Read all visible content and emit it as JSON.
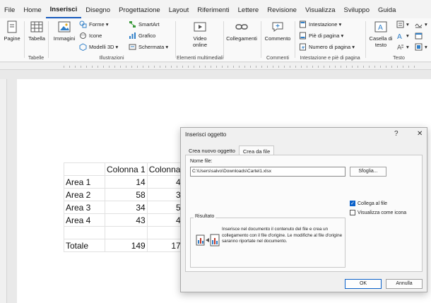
{
  "menu": {
    "tabs": [
      "File",
      "Home",
      "Inserisci",
      "Disegno",
      "Progettazione",
      "Layout",
      "Riferimenti",
      "Lettere",
      "Revisione",
      "Visualizza",
      "Sviluppo",
      "Guida"
    ],
    "active": "Inserisci"
  },
  "ribbon": {
    "pagine": "Pagine",
    "tabella": "Tabella",
    "tabelle_group": "Tabelle",
    "immagini": "Immagini",
    "forme": "Forme",
    "icone": "Icone",
    "modelli3d": "Modelli 3D",
    "smartart": "SmartArt",
    "grafico": "Grafico",
    "schermata": "Schermata",
    "illustrazioni_group": "Illustrazioni",
    "video_online": "Video online",
    "multimedia_group": "Elementi multimediali",
    "collegamenti": "Collegamenti",
    "commento": "Commento",
    "commenti_group": "Commenti",
    "intestazione": "Intestazione",
    "pie_pagina": "Piè di pagina",
    "numero_pagina": "Numero di pagina",
    "intestazione_group": "Intestazione e piè di pagina",
    "casella_testo": "Casella di testo",
    "testo_group": "Testo"
  },
  "table": {
    "headers": [
      "",
      "Colonna 1",
      "Colonna"
    ],
    "rows": [
      [
        "Area 1",
        "14",
        "4"
      ],
      [
        "Area 2",
        "58",
        "3"
      ],
      [
        "Area 3",
        "34",
        "5"
      ],
      [
        "Area 4",
        "43",
        "4"
      ],
      [
        "",
        "",
        ""
      ],
      [
        "Totale",
        "149",
        "17"
      ]
    ]
  },
  "dialog": {
    "title": "Inserisci oggetto",
    "help": "?",
    "close": "✕",
    "tabs": [
      "Crea nuovo oggetto",
      "Crea da file"
    ],
    "active_tab": "Crea da file",
    "file_label": "Nome file:",
    "file_value": "C:\\Users\\salvo\\Downloads\\Cartel1.xlsx",
    "browse": "Sfoglia...",
    "link_label": "Collega al file",
    "link_checked": true,
    "icon_label": "Visualizza come icona",
    "icon_checked": false,
    "result_title": "Risultato",
    "result_text": "Inserisce nel documento il contenuto del file e crea un collegamento con il file d'origine. Le modifiche al file d'origine saranno riportate nel documento.",
    "ok": "OK",
    "cancel": "Annulla"
  }
}
